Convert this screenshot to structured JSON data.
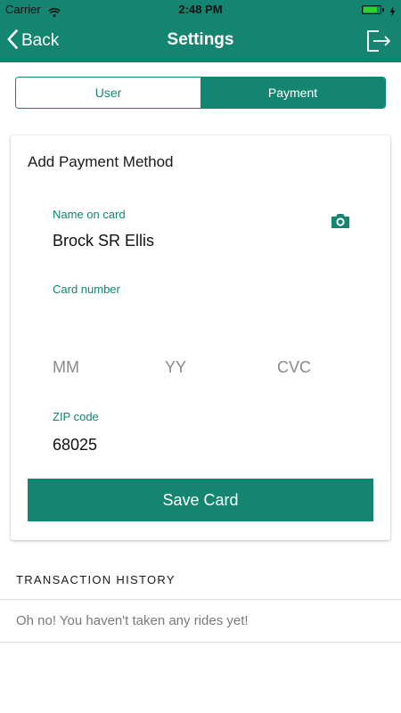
{
  "status_bar": {
    "carrier": "Carrier",
    "time": "2:48 PM",
    "battery_level": 0.85
  },
  "nav": {
    "back_label": "Back",
    "title": "Settings"
  },
  "tabs": {
    "items": [
      {
        "label": "User",
        "selected": false
      },
      {
        "label": "Payment",
        "selected": true
      }
    ]
  },
  "payment_card": {
    "title": "Add Payment Method",
    "name_label": "Name on card",
    "name_value": "Brock SR Ellis",
    "card_number_label": "Card number",
    "card_number_value": "",
    "expiry_month_placeholder": "MM",
    "expiry_year_placeholder": "YY",
    "cvc_placeholder": "CVC",
    "zip_label": "ZIP code",
    "zip_value": "68025",
    "save_label": "Save Card"
  },
  "transaction_history": {
    "title": "TRANSACTION HISTORY",
    "empty_message": "Oh no! You haven't taken any rides yet!"
  },
  "icons": {
    "wifi": "wifi-icon",
    "battery": "battery-icon",
    "charging": "charging-bolt-icon",
    "back": "chevron-left-icon",
    "logout": "logout-icon",
    "camera": "camera-icon"
  },
  "colors": {
    "brand": "#138571",
    "battery_fill": "#2fd12f",
    "muted_text": "#7a7a7a"
  }
}
